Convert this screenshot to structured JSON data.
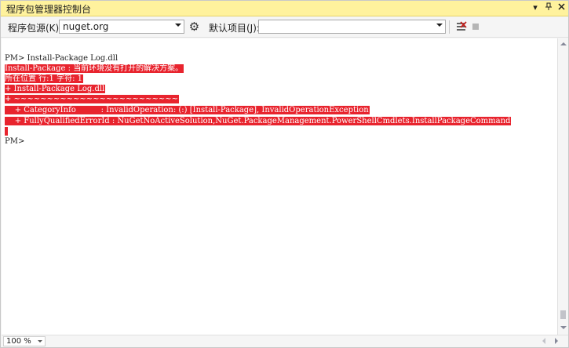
{
  "window": {
    "title": "程序包管理器控制台",
    "buttons": {
      "menu": "▼",
      "pin": "📌",
      "close": "✕"
    }
  },
  "toolbar": {
    "source_label": "程序包源(K):",
    "source_value": "nuget.org",
    "default_project_label": "默认项目(J):",
    "default_project_value": "",
    "settings_icon": "gear-icon",
    "clear_icon": "clear-console-icon",
    "stop_icon": "stop-icon"
  },
  "console": {
    "lines": [
      {
        "text": "PM> Install-Package Log.dll",
        "error": false
      },
      {
        "text": "Install-Package : 当前环境没有打开的解决方案。",
        "error": true
      },
      {
        "text": "所在位置 行:1 字符: 1",
        "error": true
      },
      {
        "text": "+ Install-Package Log.dll",
        "error": true
      },
      {
        "text": "+ ~~~~~~~~~~~~~~~~~~~~~~~~~",
        "error": true
      },
      {
        "text": "    + CategoryInfo          : InvalidOperation: (:) [Install-Package], InvalidOperationException",
        "error": true
      },
      {
        "text": "    + FullyQualifiedErrorId : NuGetNoActiveSolution,NuGet.PackageManagement.PowerShellCmdlets.InstallPackageCommand",
        "error": true
      },
      {
        "text": " ",
        "error": true
      },
      {
        "text": "PM>",
        "error": false
      }
    ]
  },
  "statusbar": {
    "zoom": "100 %"
  },
  "colors": {
    "title_bg": "#fff29d",
    "error_bg": "#e8242e",
    "error_fg": "#ffffff"
  }
}
